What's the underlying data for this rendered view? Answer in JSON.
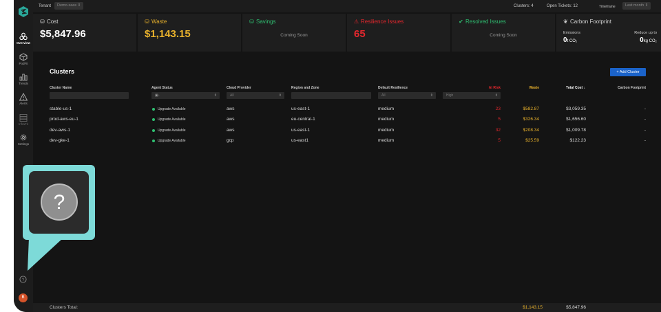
{
  "topbar": {
    "tenant_label": "Tenant",
    "tenant_value": "Demo-saas",
    "clusters_count": "Clusters: 4",
    "open_tickets": "Open Tickets: 12",
    "timeframe_label": "Timeframe",
    "timeframe_value": "Last month"
  },
  "sidebar": {
    "items": [
      {
        "label": "Overview",
        "icon": "overview-icon"
      },
      {
        "label": "PodFit",
        "icon": "podfit-icon"
      },
      {
        "label": "Trends",
        "icon": "trends-icon"
      },
      {
        "label": "Alerts",
        "icon": "alerts-icon"
      },
      {
        "label": "InfraFit",
        "icon": "infrafit-icon"
      },
      {
        "label": "Settings",
        "icon": "settings-icon"
      }
    ],
    "avatar_letter": "B"
  },
  "cards": {
    "cost": {
      "title": "Cost",
      "value": "$5,847.96"
    },
    "waste": {
      "title": "Waste",
      "value": "$1,143.15"
    },
    "savings": {
      "title": "Savings",
      "sub": "Coming Soon"
    },
    "resilience": {
      "title": "Resilience Issues",
      "value": "65"
    },
    "resolved": {
      "title": "Resolved Issues",
      "sub": "Coming Soon"
    },
    "carbon": {
      "title": "Carbon Footprint",
      "emissions_label": "Emissions",
      "emissions_value": "0",
      "emissions_unit": "t CO₂",
      "reduce_label": "Reduce up to",
      "reduce_value": "0",
      "reduce_unit": "kg CO₂"
    }
  },
  "clusters": {
    "title": "Clusters",
    "add_button": "+ Add Cluster",
    "columns": {
      "name": "Cluster Name",
      "agent": "Agent Status",
      "cloud": "Cloud Provider",
      "region": "Region and Zone",
      "resilience": "Default Resilience",
      "at_risk": "At Risk",
      "waste": "Waste",
      "total": "Total Cost ↓",
      "carbon": "Carbon Footprint"
    },
    "filters": {
      "cloud": "All",
      "resilience": "All",
      "risk": "High"
    },
    "rows": [
      {
        "name": "stable-us-1",
        "agent": "Upgrade Available",
        "cloud": "aws",
        "region": "us-east-1",
        "resilience": "medium",
        "at_risk": "23",
        "waste": "$582.87",
        "total": "$3,059.35",
        "carbon": "-"
      },
      {
        "name": "prod-aws-eu-1",
        "agent": "Upgrade Available",
        "cloud": "aws",
        "region": "eu-central-1",
        "resilience": "medium",
        "at_risk": "5",
        "waste": "$326.34",
        "total": "$1,656.60",
        "carbon": "-"
      },
      {
        "name": "dev-aws-1",
        "agent": "Upgrade Available",
        "cloud": "aws",
        "region": "us-east-1",
        "resilience": "medium",
        "at_risk": "32",
        "waste": "$208.34",
        "total": "$1,009.78",
        "carbon": "-"
      },
      {
        "name": "dev-gke-1",
        "agent": "Upgrade Available",
        "cloud": "gcp",
        "region": "us-east1",
        "resilience": "medium",
        "at_risk": "5",
        "waste": "$25.59",
        "total": "$122.23",
        "carbon": "-"
      }
    ],
    "footer": {
      "label": "Clusters Total:",
      "waste": "$1,143.15",
      "total": "$5,847.96"
    }
  },
  "colors": {
    "accent": "#7ddad8",
    "waste": "#e8b12c",
    "risk": "#e5272d",
    "success": "#2fbf71",
    "button": "#1b63c9"
  }
}
